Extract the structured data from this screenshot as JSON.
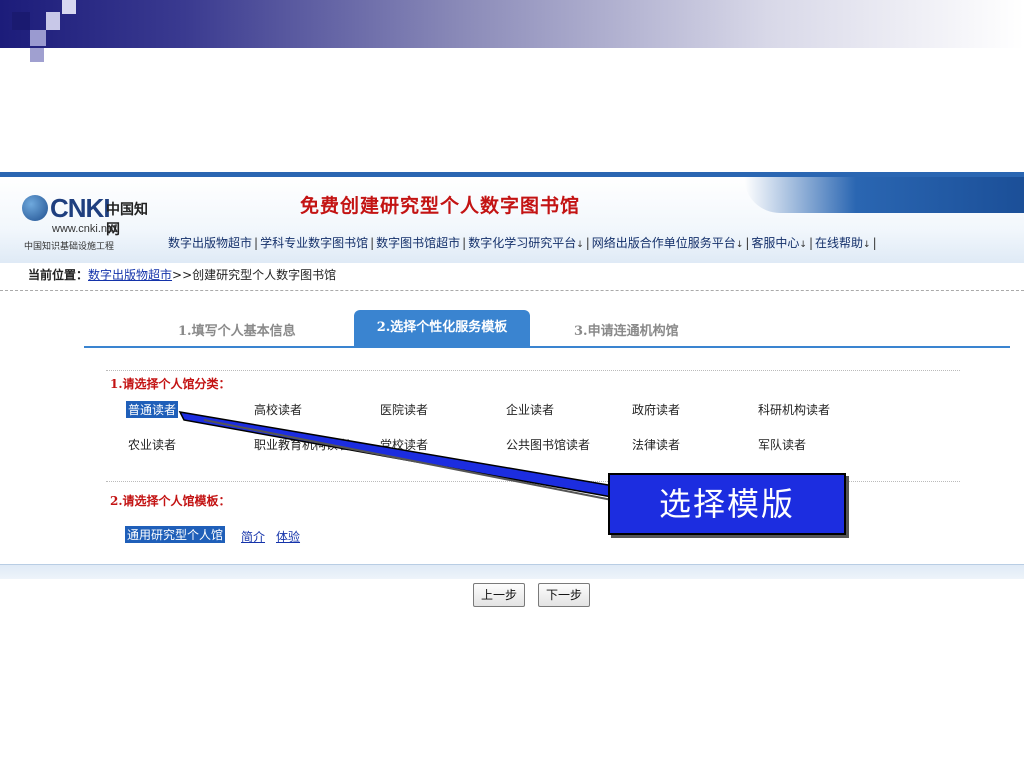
{
  "header": {
    "logo_text": "CNKI",
    "logo_cn": "中国知网",
    "logo_url": "www.cnki.net",
    "logo_sub": "中国知识基础设施工程",
    "title": "免费创建研究型个人数字图书馆",
    "nav": [
      {
        "label": "数字出版物超市",
        "dropdown": false
      },
      {
        "label": "学科专业数字图书馆",
        "dropdown": false
      },
      {
        "label": "数字图书馆超市",
        "dropdown": false
      },
      {
        "label": "数字化学习研究平台",
        "dropdown": true
      },
      {
        "label": "网络出版合作单位服务平台",
        "dropdown": true
      },
      {
        "label": "客服中心",
        "dropdown": true
      },
      {
        "label": "在线帮助",
        "dropdown": true
      }
    ]
  },
  "breadcrumb": {
    "label": "当前位置：",
    "link": "数字出版物超市",
    "rest": ">>创建研究型个人数字图书馆"
  },
  "steps": [
    {
      "label": "1.填写个人基本信息",
      "active": false
    },
    {
      "label": "2.选择个性化服务模板",
      "active": true
    },
    {
      "label": "3.申请连通机构馆",
      "active": false
    }
  ],
  "section1": {
    "title": "1.请选择个人馆分类：",
    "categories": [
      {
        "label": "普通读者",
        "selected": true
      },
      {
        "label": "高校读者",
        "selected": false
      },
      {
        "label": "医院读者",
        "selected": false
      },
      {
        "label": "企业读者",
        "selected": false
      },
      {
        "label": "政府读者",
        "selected": false
      },
      {
        "label": "科研机构读者",
        "selected": false
      },
      {
        "label": "农业读者",
        "selected": false
      },
      {
        "label": "职业教育机构读者",
        "selected": false
      },
      {
        "label": "党校读者",
        "selected": false
      },
      {
        "label": "公共图书馆读者",
        "selected": false
      },
      {
        "label": "法律读者",
        "selected": false
      },
      {
        "label": "军队读者",
        "selected": false
      }
    ]
  },
  "section2": {
    "title": "2.请选择个人馆模板：",
    "template": "通用研究型个人馆",
    "links": [
      "简介",
      "体验"
    ]
  },
  "buttons": {
    "prev": "上一步",
    "next": "下一步"
  },
  "callout": {
    "text": "选择模版"
  },
  "colors": {
    "brand_blue": "#2a66b2",
    "title_red": "#c31313",
    "selected_bg": "#1f5fb9",
    "callout_bg": "#1c2de0"
  }
}
